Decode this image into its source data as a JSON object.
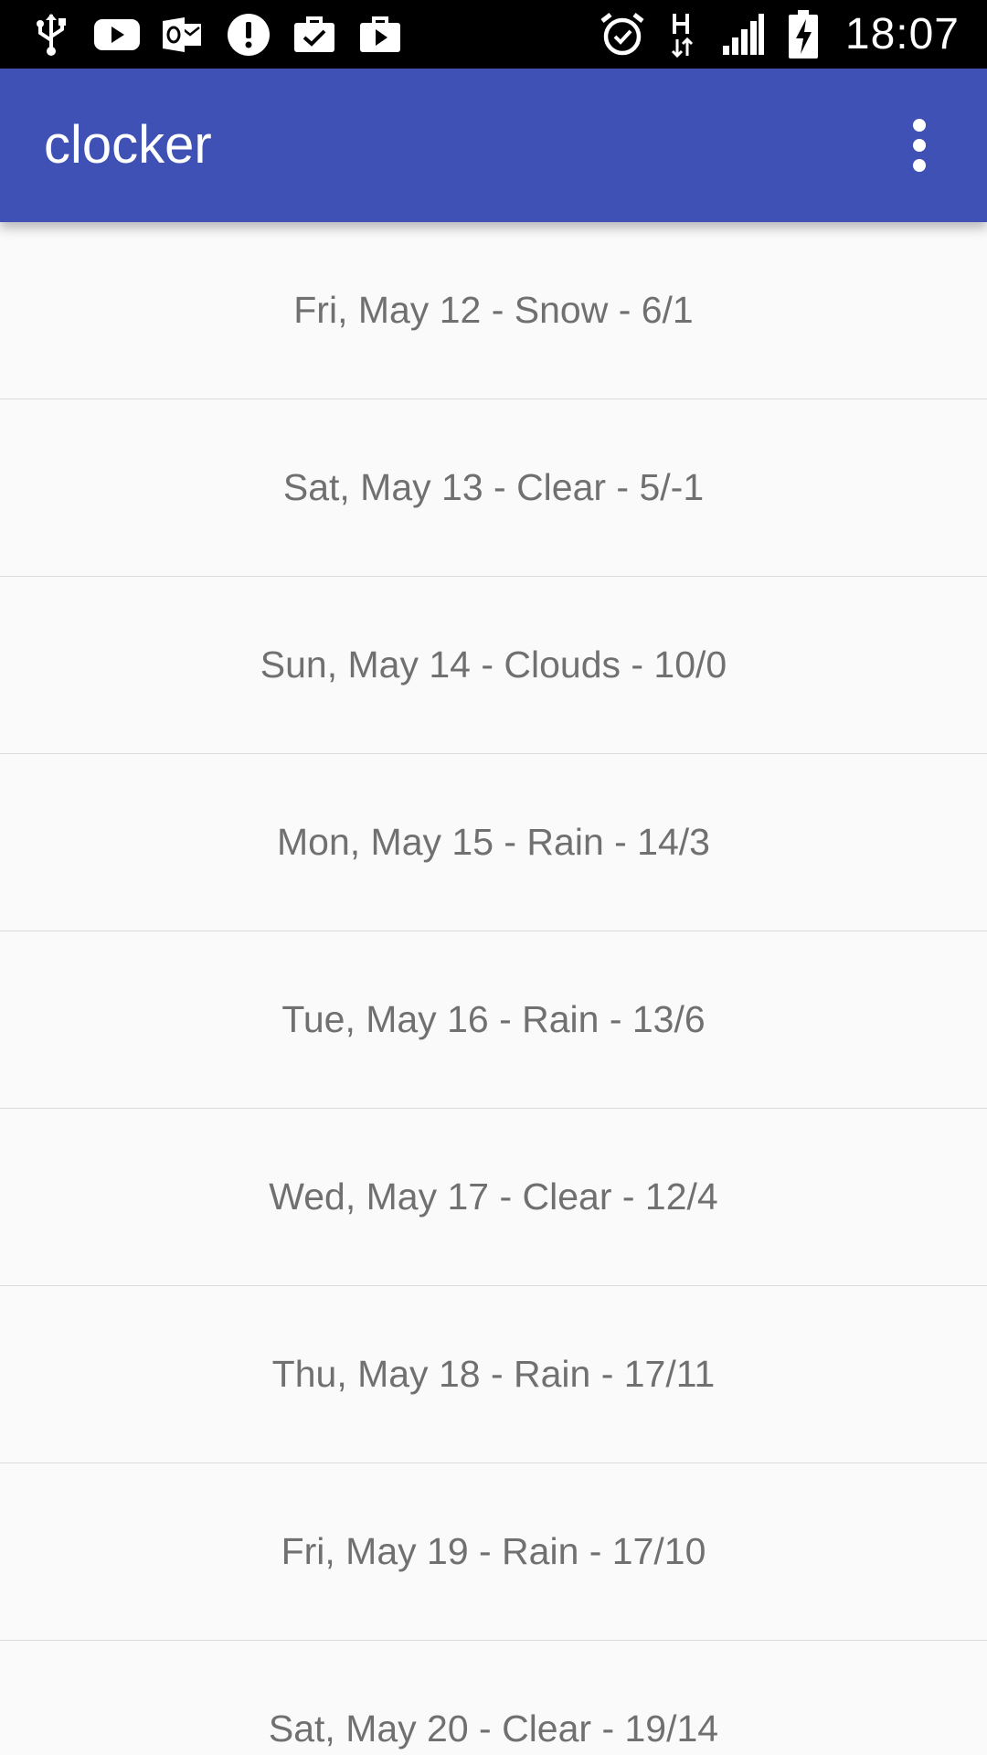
{
  "status_bar": {
    "time": "18:07",
    "left_icons": [
      "usb-icon",
      "youtube-icon",
      "outlook-icon",
      "alert-icon",
      "briefcase-check-icon",
      "briefcase-play-icon"
    ],
    "right_icons": [
      "alarm-icon",
      "network-h-icon",
      "signal-icon",
      "battery-charging-icon"
    ]
  },
  "app_bar": {
    "title": "clocker",
    "background_color": "#3f51b5",
    "menu_icon": "more-vert-icon"
  },
  "forecast": [
    {
      "label": "Fri, May 12 - Snow - 6/1"
    },
    {
      "label": "Sat, May 13 - Clear - 5/-1"
    },
    {
      "label": "Sun, May 14 - Clouds - 10/0"
    },
    {
      "label": "Mon, May 15 - Rain - 14/3"
    },
    {
      "label": "Tue, May 16 - Rain - 13/6"
    },
    {
      "label": "Wed, May 17 - Clear - 12/4"
    },
    {
      "label": "Thu, May 18 - Rain - 17/11"
    },
    {
      "label": "Fri, May 19 - Rain - 17/10"
    },
    {
      "label": "Sat, May 20 - Clear - 19/14"
    }
  ]
}
